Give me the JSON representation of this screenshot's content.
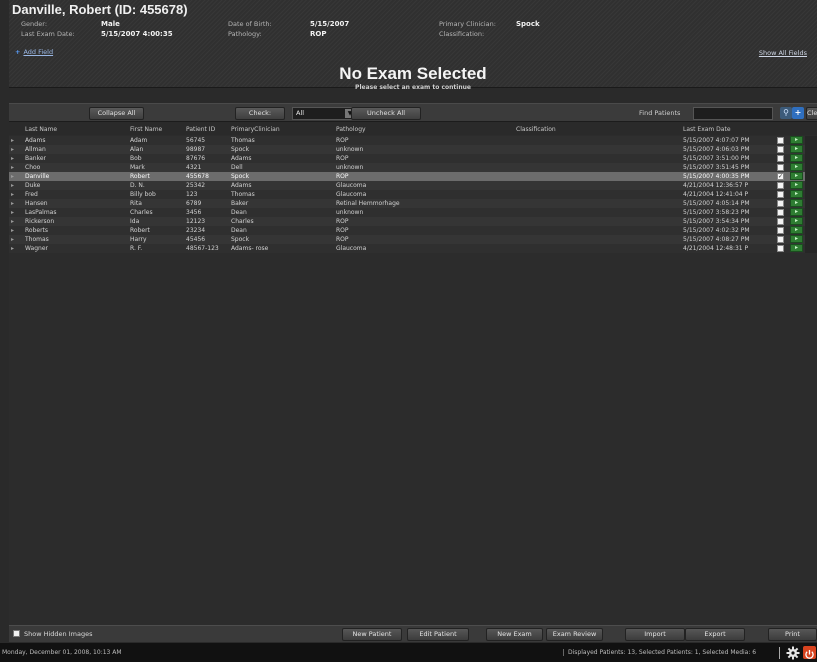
{
  "patient": {
    "title": "Danville, Robert (ID: 455678)",
    "gender_label": "Gender:",
    "gender": "Male",
    "last_exam_label": "Last Exam Date:",
    "last_exam": "5/15/2007 4:00:35",
    "dob_label": "Date of Birth:",
    "dob": "5/15/2007",
    "pathology_label": "Pathology:",
    "pathology": "ROP",
    "clinician_label": "Primary Clinician:",
    "clinician": "Spock",
    "classification_label": "Classification:",
    "classification": "",
    "add_field": "Add Field",
    "show_all_fields": "Show All Fields"
  },
  "exam": {
    "title": "No Exam Selected",
    "subtitle": "Please select an exam to continue"
  },
  "toolbar": {
    "collapse_all": "Collapse All",
    "check_label": "Check:",
    "filter_value": "All",
    "uncheck_all": "Uncheck All",
    "find_label": "Find Patients",
    "find_value": "",
    "clear": "Clea"
  },
  "table": {
    "headers": {
      "last_name": "Last Name",
      "first_name": "First Name",
      "patient_id": "Patient ID",
      "clinician": "PrimaryClinician",
      "pathology": "Pathology",
      "classification": "Classification",
      "last_exam": "Last Exam Date"
    },
    "rows": [
      {
        "last": "Adams",
        "first": "Adam",
        "id": "56745",
        "clinician": "Thomas",
        "pathology": "ROP",
        "classification": "",
        "date": "5/15/2007 4:07:07 PM",
        "checked": false,
        "selected": false
      },
      {
        "last": "Allman",
        "first": "Alan",
        "id": "98987",
        "clinician": "Spock",
        "pathology": "unknown",
        "classification": "",
        "date": "5/15/2007 4:06:03 PM",
        "checked": false,
        "selected": false
      },
      {
        "last": "Banker",
        "first": "Bob",
        "id": "87676",
        "clinician": "Adams",
        "pathology": "ROP",
        "classification": "",
        "date": "5/15/2007 3:51:00 PM",
        "checked": false,
        "selected": false
      },
      {
        "last": "Choo",
        "first": "Mark",
        "id": "4321",
        "clinician": "Dell",
        "pathology": "unknown",
        "classification": "",
        "date": "5/15/2007 3:51:45 PM",
        "checked": false,
        "selected": false
      },
      {
        "last": "Danville",
        "first": "Robert",
        "id": "455678",
        "clinician": "Spock",
        "pathology": "ROP",
        "classification": "",
        "date": "5/15/2007 4:00:35 PM",
        "checked": true,
        "selected": true
      },
      {
        "last": "Duke",
        "first": "D. N.",
        "id": "25342",
        "clinician": "Adams",
        "pathology": "Glaucoma",
        "classification": "",
        "date": "4/21/2004 12:36:57 P",
        "checked": false,
        "selected": false
      },
      {
        "last": "Fred",
        "first": "Billy bob",
        "id": "123",
        "clinician": "Thomas",
        "pathology": "Glaucoma",
        "classification": "",
        "date": "4/21/2004 12:41:04 P",
        "checked": false,
        "selected": false
      },
      {
        "last": "Hansen",
        "first": "Rita",
        "id": "6789",
        "clinician": "Baker",
        "pathology": "Retinal Hemmorhage",
        "classification": "",
        "date": "5/15/2007 4:05:14 PM",
        "checked": false,
        "selected": false
      },
      {
        "last": "LasPalmas",
        "first": "Charles",
        "id": "3456",
        "clinician": "Dean",
        "pathology": "unknown",
        "classification": "",
        "date": "5/15/2007 3:58:23 PM",
        "checked": false,
        "selected": false
      },
      {
        "last": "Rickerson",
        "first": "Ida",
        "id": "12123",
        "clinician": "Charles",
        "pathology": "ROP",
        "classification": "",
        "date": "5/15/2007 3:54:34 PM",
        "checked": false,
        "selected": false
      },
      {
        "last": "Roberts",
        "first": "Robert",
        "id": "23234",
        "clinician": "Dean",
        "pathology": "ROP",
        "classification": "",
        "date": "5/15/2007 4:02:32 PM",
        "checked": false,
        "selected": false
      },
      {
        "last": "Thomas",
        "first": "Harry",
        "id": "45456",
        "clinician": "Spock",
        "pathology": "ROP",
        "classification": "",
        "date": "5/15/2007 4:08:27 PM",
        "checked": false,
        "selected": false
      },
      {
        "last": "Wagner",
        "first": "R. F.",
        "id": "48567-123",
        "clinician": "Adams- rose",
        "pathology": "Glaucoma",
        "classification": "",
        "date": "4/21/2004 12:48:31 P",
        "checked": false,
        "selected": false
      }
    ]
  },
  "bottom": {
    "show_hidden": "Show Hidden Images",
    "new_patient": "New Patient",
    "edit_patient": "Edit Patient",
    "new_exam": "New Exam",
    "exam_review": "Exam Review",
    "import": "Import",
    "export": "Export",
    "print": "Print"
  },
  "status": {
    "datetime": "Monday, December 01, 2008, 10:13 AM",
    "counts": "Displayed Patients: 13, Selected Patients: 1, Selected Media: 6"
  },
  "icons": {
    "expander": "expand-arrow-icon",
    "search": "magnifier-icon",
    "add": "plus-icon",
    "settings": "gear-icon",
    "power": "power-icon",
    "open_exam": "green-arrow-icon"
  },
  "colors": {
    "selected_row": "#6c6c6c",
    "open_exam_button": "#2e7d32",
    "power_button": "#d8431f",
    "link": "#9ab8e6"
  }
}
